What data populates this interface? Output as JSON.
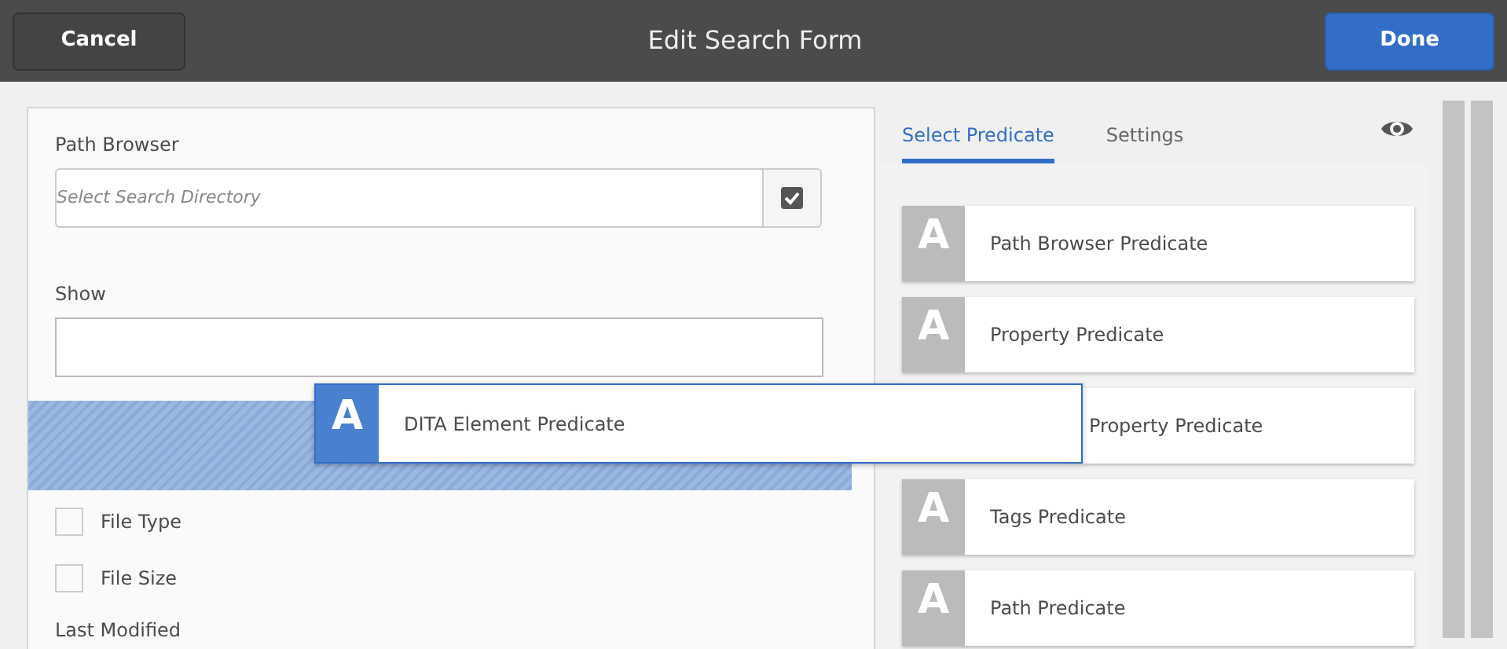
{
  "header": {
    "cancel": "Cancel",
    "title": "Edit Search Form",
    "done": "Done"
  },
  "form": {
    "path_browser": {
      "label": "Path Browser",
      "placeholder": "Select Search Directory",
      "checked": true
    },
    "show": {
      "label": "Show"
    },
    "checkboxes": [
      {
        "label": "File Type",
        "checked": false
      },
      {
        "label": "File Size",
        "checked": false
      }
    ],
    "last_label": "Last Modified"
  },
  "dragged": {
    "letter": "A",
    "label": "DITA Element Predicate"
  },
  "tabs": [
    {
      "label": "Select Predicate",
      "selected": true
    },
    {
      "label": "Settings",
      "selected": false
    }
  ],
  "predicates": [
    {
      "letter": "A",
      "label": "Path Browser Predicate",
      "kind": "plain"
    },
    {
      "letter": "A",
      "label": "Property Predicate",
      "kind": "plain"
    },
    {
      "label": "Property Predicate",
      "kind": "covered"
    },
    {
      "letter": "A",
      "label": "Tags Predicate",
      "kind": "plain"
    },
    {
      "letter": "A",
      "label": "Path Predicate",
      "kind": "plain"
    }
  ]
}
